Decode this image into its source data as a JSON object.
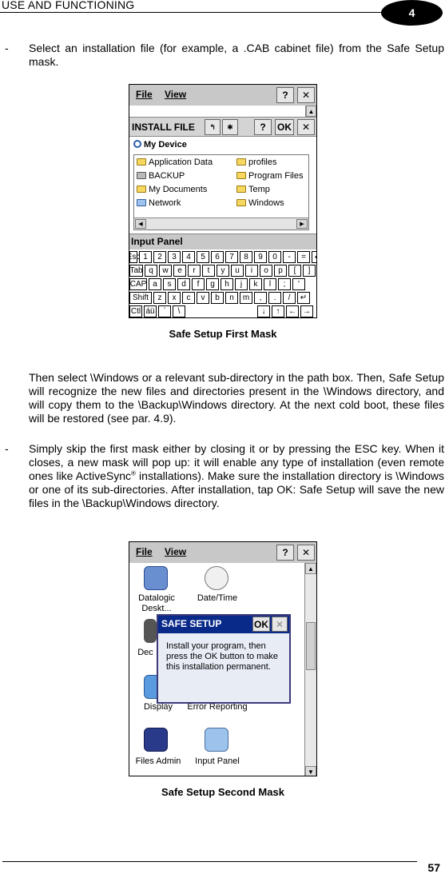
{
  "header": {
    "section_title": "USE AND FUNCTIONING",
    "chapter": "4"
  },
  "footer": {
    "page_number": "57"
  },
  "body": {
    "dash": "-",
    "bullet1": "Select an installation file (for example, a .CAB cabinet file) from the Safe Setup mask.",
    "para2": "Then select \\Windows or a relevant sub-directory in the path box. Then, Safe Setup will recognize the new files and directories present in the \\Windows directory, and will copy them to the \\Backup\\Windows directory. At the next cold boot, these files will be restored (see par. 4.9).",
    "bullet2_a": "Simply skip the first mask either by closing it or by pressing the ESC key. When it closes, a new mask will pop up: it will enable any type of installation (even remote ones like ActiveSync",
    "bullet2_reg": "®",
    "bullet2_b": " installations). Make sure the installation directory is \\Windows or one of its sub-directories. After installation, tap OK: Safe Setup will save the new files in the \\Backup\\Windows directory."
  },
  "figure1": {
    "caption": "Safe Setup First Mask",
    "menu_file": "File",
    "menu_view": "View",
    "help_btn": "?",
    "close_btn": "✕",
    "dialog_title": "INSTALL FILE",
    "ok_btn": "OK",
    "location": "My Device",
    "files_col1": [
      "Application Data",
      "BACKUP",
      "My Documents",
      "Network"
    ],
    "files_col2": [
      "profiles",
      "Program Files",
      "Temp",
      "Windows"
    ],
    "panel_title": "Input Panel",
    "keyboard": {
      "row1": [
        "Esc",
        "1",
        "2",
        "3",
        "4",
        "5",
        "6",
        "7",
        "8",
        "9",
        "0",
        "-",
        "=",
        "◆"
      ],
      "row2": [
        "Tab",
        "q",
        "w",
        "e",
        "r",
        "t",
        "y",
        "u",
        "i",
        "o",
        "p",
        "[",
        "]"
      ],
      "row3": [
        "CAP",
        "a",
        "s",
        "d",
        "f",
        "g",
        "h",
        "j",
        "k",
        "l",
        ";",
        "'"
      ],
      "row4": [
        "Shift",
        "z",
        "x",
        "c",
        "v",
        "b",
        "n",
        "m",
        ",",
        ".",
        "/",
        "↵"
      ],
      "row5": [
        "Ctl",
        "áü",
        "`",
        "\\",
        "↓",
        "↑",
        "←",
        "→"
      ]
    }
  },
  "figure2": {
    "caption": "Safe Setup Second Mask",
    "menu_file": "File",
    "menu_view": "View",
    "help_btn": "?",
    "close_btn": "✕",
    "icons": {
      "datalogic": "Datalogic Deskt...",
      "datetime": "Date/Time",
      "device": "Dec",
      "display": "Display",
      "error": "Error Reporting",
      "filesadmin": "Files Admin",
      "inputpanel": "Input Panel"
    },
    "popup_title": "SAFE SETUP",
    "popup_ok": "OK",
    "popup_close": "✕",
    "popup_msg": "Install your program, then press the OK button to make this installation permanent."
  }
}
